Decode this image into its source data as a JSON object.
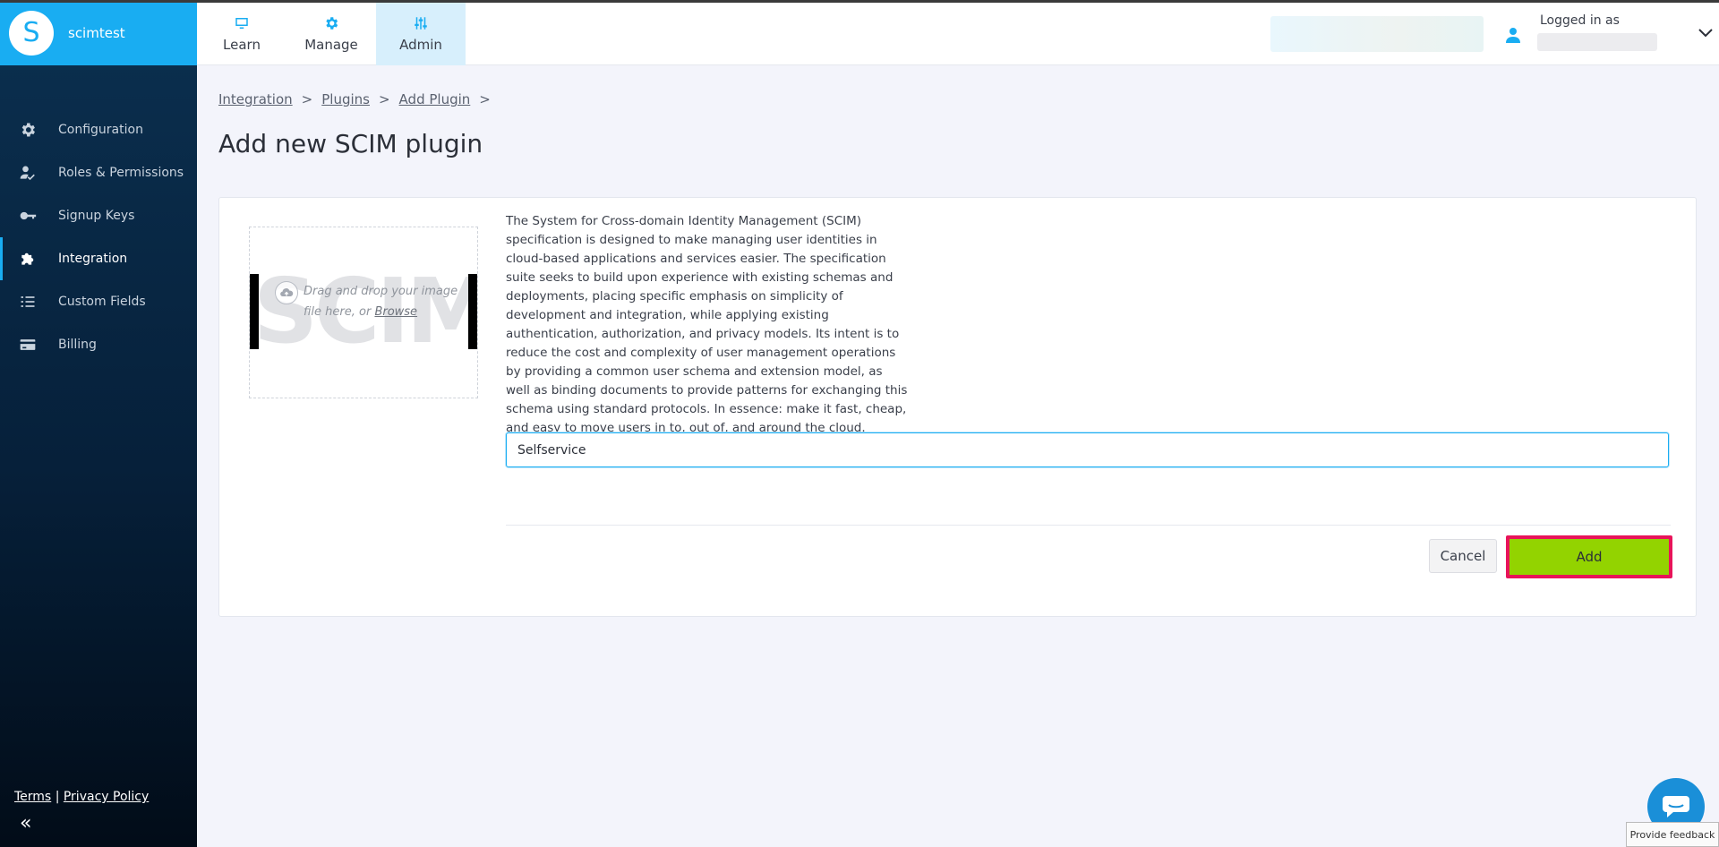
{
  "app": {
    "name": "scimtest",
    "logo_letter": "S"
  },
  "tabs": [
    {
      "label": "Learn",
      "icon": "monitor-icon",
      "active": false
    },
    {
      "label": "Manage",
      "icon": "gear-icon",
      "active": false
    },
    {
      "label": "Admin",
      "icon": "sliders-icon",
      "active": true
    }
  ],
  "header": {
    "logged_in_label": "Logged in as"
  },
  "sidebar": {
    "items": [
      {
        "label": "Configuration",
        "icon": "gear-icon"
      },
      {
        "label": "Roles & Permissions",
        "icon": "user-check-icon"
      },
      {
        "label": "Signup Keys",
        "icon": "key-icon"
      },
      {
        "label": "Integration",
        "icon": "puzzle-icon",
        "active": true
      },
      {
        "label": "Custom Fields",
        "icon": "list-icon"
      },
      {
        "label": "Billing",
        "icon": "credit-card-icon"
      }
    ],
    "terms": "Terms",
    "separator": "|",
    "privacy": "Privacy Policy",
    "collapse": "«"
  },
  "breadcrumb": {
    "items": [
      "Integration",
      "Plugins",
      "Add Plugin"
    ],
    "sep": ">"
  },
  "page": {
    "title": "Add new SCIM plugin"
  },
  "plugin": {
    "logo_text": "SCIM",
    "dropzone_text": "Drag and drop your image file here, or",
    "browse": "Browse",
    "description": "The System for Cross-domain Identity Management (SCIM) specification is designed to make managing user identities in cloud-based applications and services easier. The specification suite seeks to build upon experience with existing schemas and deployments, placing specific emphasis on simplicity of development and integration, while applying existing authentication, authorization, and privacy models. Its intent is to reduce the cost and complexity of user management operations by providing a common user schema and extension model, as well as binding documents to provide patterns for exchanging this schema using standard protocols. In essence: make it fast, cheap, and easy to move users in to, out of, and around the cloud.",
    "name_value": "Selfservice"
  },
  "actions": {
    "cancel": "Cancel",
    "add": "Add"
  },
  "feedback": "Provide feedback",
  "colors": {
    "brand": "#19adf2",
    "add_button": "#93d300",
    "highlight": "#e8145a"
  }
}
